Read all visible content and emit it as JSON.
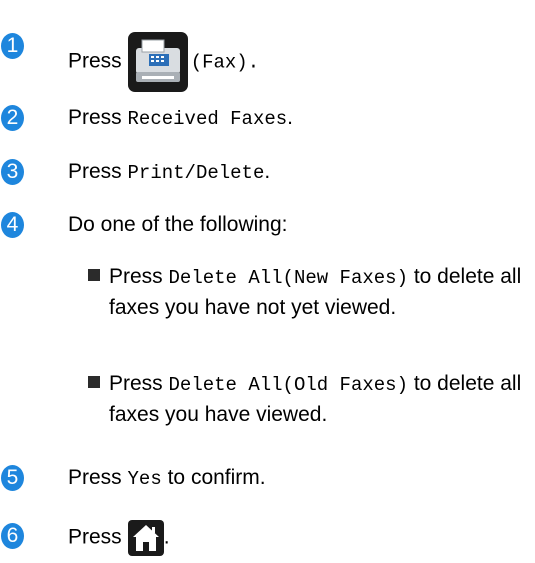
{
  "steps": [
    {
      "num": "1",
      "press": "Press",
      "icon": "fax-icon",
      "suffix": "(Fax)."
    },
    {
      "num": "2",
      "press": "Press",
      "code": "Received Faxes",
      "end": "."
    },
    {
      "num": "3",
      "press": "Press",
      "code": "Print/Delete",
      "end": "."
    },
    {
      "num": "4",
      "text": "Do one of the following:",
      "bullets": [
        {
          "press": "Press",
          "code": "Delete All(New Faxes)",
          "rest": "to delete all faxes you have not yet viewed."
        },
        {
          "press": "Press",
          "code": "Delete All(Old Faxes)",
          "rest": "to delete all faxes you have viewed."
        }
      ]
    },
    {
      "num": "5",
      "press": "Press",
      "code": "Yes",
      "rest": "to confirm."
    },
    {
      "num": "6",
      "press": "Press",
      "icon": "home-icon",
      "end": "."
    }
  ],
  "colors": {
    "step_badge": "#1e86dd",
    "icon_bg": "#1a1a1a"
  }
}
